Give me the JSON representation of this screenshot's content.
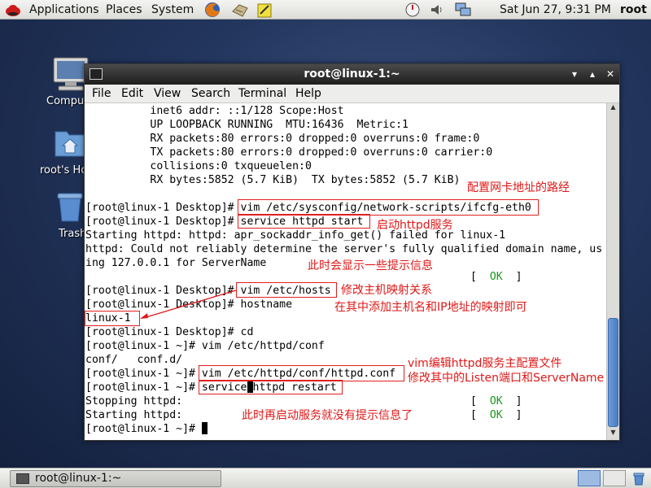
{
  "top_panel": {
    "applications": "Applications",
    "places": "Places",
    "system": "System",
    "clock": "Sat Jun 27,  9:31 PM",
    "user": "root"
  },
  "desktop_icons": {
    "computer": "Compu",
    "home": "root's Ho",
    "trash": "Trash"
  },
  "window": {
    "title": "root@linux-1:~",
    "menu": [
      "File",
      "Edit",
      "View",
      "Search",
      "Terminal",
      "Help"
    ],
    "minimize": "▾",
    "maximize": "▴",
    "close": "✕"
  },
  "terminal": {
    "lines": [
      "          inet6 addr: ::1/128 Scope:Host",
      "          UP LOOPBACK RUNNING  MTU:16436  Metric:1",
      "          RX packets:80 errors:0 dropped:0 overruns:0 frame:0",
      "          TX packets:80 errors:0 dropped:0 overruns:0 carrier:0",
      "          collisions:0 txqueuelen:0",
      "          RX bytes:5852 (5.7 KiB)  TX bytes:5852 (5.7 KiB)",
      "",
      "[root@linux-1 Desktop]# vim /etc/sysconfig/network-scripts/ifcfg-eth0",
      "[root@linux-1 Desktop]# service httpd start",
      "Starting httpd: httpd: apr_sockaddr_info_get() failed for linux-1",
      "httpd: Could not reliably determine the server's fully qualified domain name, us",
      "ing 127.0.0.1 for ServerName",
      "",
      "[root@linux-1 Desktop]# vim /etc/hosts",
      "[root@linux-1 Desktop]# hostname",
      "linux-1",
      "[root@linux-1 Desktop]# cd",
      "[root@linux-1 ~]# vim /etc/httpd/conf",
      "conf/   conf.d/",
      "[root@linux-1 ~]# vim /etc/httpd/conf/httpd.conf",
      "[root@linux-1 ~]# service",
      "Stopping httpd:",
      "Starting httpd:",
      "[root@linux-1 ~]# "
    ],
    "restart_tail": "httpd restart",
    "ok_lbracket": "[  ",
    "ok_word": "OK",
    "ok_rbracket": "  ]"
  },
  "annotations": {
    "ifcfg_path": "配置网卡地址的路经",
    "start_httpd": "启动httpd服务",
    "hints": "此时会显示一些提示信息",
    "hosts_edit": "修改主机映射关系",
    "hosts_add": "在其中添加主机名和IP地址的映射即可",
    "vim_conf": "vim编辑httpd服务主配置文件",
    "listen_port": "修改其中的Listen端口和ServerName",
    "no_hints": "此时再启动服务就没有提示信息了"
  },
  "taskbar": {
    "task_label": "root@linux-1:~"
  },
  "colors": {
    "annotation": "#e01818",
    "ok_green": "#1a9a1a",
    "titlebar": "#2a2a2a"
  }
}
